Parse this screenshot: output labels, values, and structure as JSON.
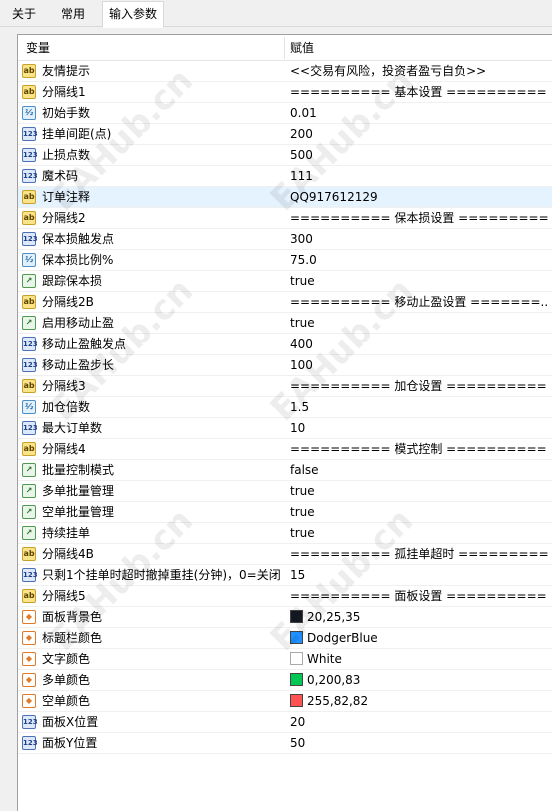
{
  "tabs": [
    {
      "label": "关于",
      "active": false
    },
    {
      "label": "常用",
      "active": false
    },
    {
      "label": "输入参数",
      "active": true
    }
  ],
  "columns": {
    "variable": "变量",
    "value": "赋值"
  },
  "rows": [
    {
      "type": "ab",
      "icon": "string-icon",
      "name": "友情提示",
      "value": "<<交易有风险，投资者盈亏自负>>"
    },
    {
      "type": "ab",
      "icon": "string-icon",
      "name": "分隔线1",
      "value": "========== 基本设置 =========="
    },
    {
      "type": "v2",
      "icon": "double-icon",
      "name": "初始手数",
      "value": "0.01"
    },
    {
      "type": "i123",
      "icon": "integer-icon",
      "name": "挂单间距(点)",
      "value": "200"
    },
    {
      "type": "i123",
      "icon": "integer-icon",
      "name": "止损点数",
      "value": "500"
    },
    {
      "type": "i123",
      "icon": "integer-icon",
      "name": "魔术码",
      "value": "111"
    },
    {
      "type": "ab",
      "icon": "string-icon",
      "name": "订单注释",
      "value": "QQ917612129",
      "selected": true
    },
    {
      "type": "ab",
      "icon": "string-icon",
      "name": "分隔线2",
      "value": "========== 保本损设置 =========="
    },
    {
      "type": "i123",
      "icon": "integer-icon",
      "name": "保本损触发点",
      "value": "300"
    },
    {
      "type": "v2",
      "icon": "double-icon",
      "name": "保本损比例%",
      "value": "75.0"
    },
    {
      "type": "bool",
      "icon": "bool-icon",
      "name": "跟踪保本损",
      "value": "true"
    },
    {
      "type": "ab",
      "icon": "string-icon",
      "name": "分隔线2B",
      "value": "========== 移动止盈设置 =======..."
    },
    {
      "type": "bool",
      "icon": "bool-icon",
      "name": "启用移动止盈",
      "value": "true"
    },
    {
      "type": "i123",
      "icon": "integer-icon",
      "name": "移动止盈触发点",
      "value": "400"
    },
    {
      "type": "i123",
      "icon": "integer-icon",
      "name": "移动止盈步长",
      "value": "100"
    },
    {
      "type": "ab",
      "icon": "string-icon",
      "name": "分隔线3",
      "value": "========== 加仓设置 =========="
    },
    {
      "type": "v2",
      "icon": "double-icon",
      "name": "加仓倍数",
      "value": "1.5"
    },
    {
      "type": "i123",
      "icon": "integer-icon",
      "name": "最大订单数",
      "value": "10"
    },
    {
      "type": "ab",
      "icon": "string-icon",
      "name": "分隔线4",
      "value": "========== 模式控制 =========="
    },
    {
      "type": "bool",
      "icon": "bool-icon",
      "name": "批量控制模式",
      "value": "false"
    },
    {
      "type": "bool",
      "icon": "bool-icon",
      "name": "多单批量管理",
      "value": "true"
    },
    {
      "type": "bool",
      "icon": "bool-icon",
      "name": "空单批量管理",
      "value": "true"
    },
    {
      "type": "bool",
      "icon": "bool-icon",
      "name": "持续挂单",
      "value": "true"
    },
    {
      "type": "ab",
      "icon": "string-icon",
      "name": "分隔线4B",
      "value": "========== 孤挂单超时 =========="
    },
    {
      "type": "i123",
      "icon": "integer-icon",
      "name": "只剩1个挂单时超时撤掉重挂(分钟)，0=关闭",
      "value": "15"
    },
    {
      "type": "ab",
      "icon": "string-icon",
      "name": "分隔线5",
      "value": "========== 面板设置 =========="
    },
    {
      "type": "color",
      "icon": "color-icon",
      "name": "面板背景色",
      "value": "20,25,35",
      "swatch": "#141923"
    },
    {
      "type": "color",
      "icon": "color-icon",
      "name": "标题栏颜色",
      "value": "DodgerBlue",
      "swatch": "#1e90ff"
    },
    {
      "type": "color",
      "icon": "color-icon",
      "name": "文字颜色",
      "value": "White",
      "swatch": "#ffffff"
    },
    {
      "type": "color",
      "icon": "color-icon",
      "name": "多单颜色",
      "value": "0,200,83",
      "swatch": "#00c853"
    },
    {
      "type": "color",
      "icon": "color-icon",
      "name": "空单颜色",
      "value": "255,82,82",
      "swatch": "#ff5252"
    },
    {
      "type": "i123",
      "icon": "integer-icon",
      "name": "面板X位置",
      "value": "20"
    },
    {
      "type": "i123",
      "icon": "integer-icon",
      "name": "面板Y位置",
      "value": "50"
    }
  ],
  "icon_glyphs": {
    "ab": "ab",
    "i123": "123",
    "v2": "½",
    "bool": "↗",
    "color": "◆"
  },
  "watermark": "EAHub.cn"
}
